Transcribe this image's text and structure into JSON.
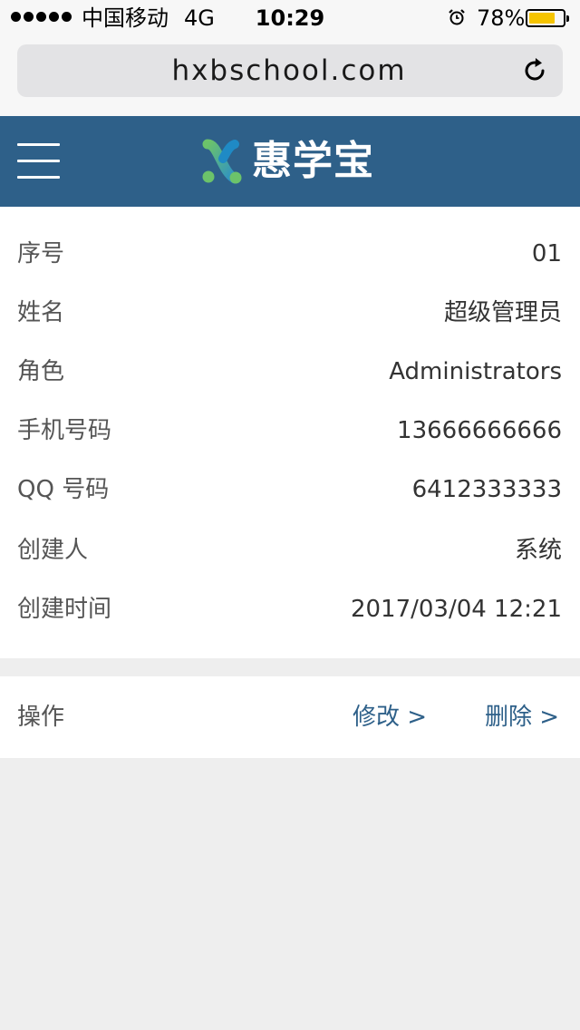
{
  "status_bar": {
    "carrier": "中国移动",
    "network": "4G",
    "time": "10:29",
    "battery_percent": "78%",
    "battery_level": 0.78,
    "icons": [
      "signal-dots-icon",
      "alarm-icon",
      "battery-icon"
    ]
  },
  "browser": {
    "url": "hxbschool.com",
    "icons": [
      "reload-icon"
    ]
  },
  "header": {
    "brand": "惠学宝",
    "background_color": "#2e6089",
    "icons": [
      "menu-icon",
      "logo-x-icon"
    ]
  },
  "details": [
    {
      "label": "序号",
      "value": "01"
    },
    {
      "label": "姓名",
      "value": "超级管理员"
    },
    {
      "label": "角色",
      "value": "Administrators"
    },
    {
      "label": "手机号码",
      "value": "13666666666"
    },
    {
      "label": "QQ 号码",
      "value": "6412333333"
    },
    {
      "label": "创建人",
      "value": "系统"
    },
    {
      "label": "创建时间",
      "value": "2017/03/04 12:21"
    }
  ],
  "actions": {
    "label": "操作",
    "edit": "修改 >",
    "delete": "删除 >",
    "link_color": "#2e6089"
  }
}
